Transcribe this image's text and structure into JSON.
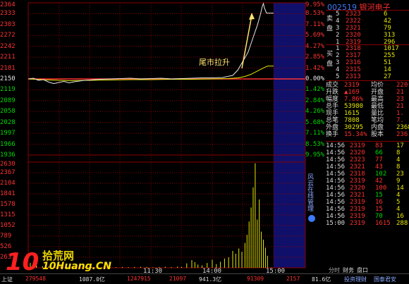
{
  "stock": {
    "code": "002519",
    "name": "银河电子"
  },
  "chart_data": {
    "type": "line",
    "prev_close": 2150,
    "y_ticks_left": [
      "2364",
      "2333",
      "2303",
      "2272",
      "2242",
      "2211",
      "2181",
      "2150",
      "2119",
      "2089",
      "2058",
      "2028",
      "1997",
      "1966",
      "1936"
    ],
    "y_ticks_right": [
      "9.95%",
      "8.53%",
      "7.11%",
      "5.69%",
      "4.27%",
      "2.85%",
      "1.42%",
      "0.00%",
      "1.42%",
      "2.84%",
      "4.26%",
      "5.68%",
      "7.11%",
      "8.53%",
      "9.95%"
    ],
    "volume_ticks": [
      "2630",
      "2367",
      "2104",
      "1841",
      "1578",
      "1315",
      "1052",
      "789",
      "526",
      "263"
    ],
    "x_ticks": [
      "11:30",
      "14:00",
      "15:00"
    ],
    "annotation": "尾市拉升",
    "price_series": [
      [
        0,
        2150
      ],
      [
        5,
        2152
      ],
      [
        10,
        2146
      ],
      [
        15,
        2148
      ],
      [
        20,
        2141
      ],
      [
        25,
        2137
      ],
      [
        30,
        2140
      ],
      [
        35,
        2143
      ],
      [
        40,
        2139
      ],
      [
        45,
        2142
      ],
      [
        50,
        2144
      ],
      [
        55,
        2146
      ],
      [
        60,
        2147
      ],
      [
        65,
        2148
      ],
      [
        70,
        2149
      ],
      [
        80,
        2150
      ],
      [
        90,
        2151
      ],
      [
        100,
        2152
      ],
      [
        110,
        2150
      ],
      [
        120,
        2151
      ],
      [
        130,
        2152
      ],
      [
        140,
        2150
      ],
      [
        150,
        2151
      ],
      [
        160,
        2152
      ],
      [
        170,
        2153
      ],
      [
        180,
        2153
      ],
      [
        190,
        2154
      ],
      [
        200,
        2160
      ],
      [
        205,
        2175
      ],
      [
        210,
        2200
      ],
      [
        215,
        2225
      ],
      [
        218,
        2250
      ],
      [
        221,
        2275
      ],
      [
        224,
        2300
      ],
      [
        227,
        2330
      ],
      [
        229,
        2355
      ],
      [
        230,
        2362
      ],
      [
        231,
        2350
      ],
      [
        233,
        2335
      ],
      [
        237,
        2335
      ],
      [
        240,
        2335
      ]
    ],
    "avg_series": [
      [
        0,
        2150
      ],
      [
        20,
        2147
      ],
      [
        40,
        2145
      ],
      [
        60,
        2146
      ],
      [
        80,
        2147
      ],
      [
        100,
        2148
      ],
      [
        120,
        2148
      ],
      [
        140,
        2149
      ],
      [
        160,
        2149
      ],
      [
        180,
        2150
      ],
      [
        195,
        2151
      ],
      [
        205,
        2153
      ],
      [
        212,
        2157
      ],
      [
        218,
        2163
      ],
      [
        224,
        2172
      ],
      [
        230,
        2181
      ],
      [
        234,
        2186
      ],
      [
        240,
        2186
      ]
    ],
    "volume_series": [
      [
        2,
        120
      ],
      [
        8,
        60
      ],
      [
        14,
        40
      ],
      [
        20,
        35
      ],
      [
        26,
        25
      ],
      [
        32,
        30
      ],
      [
        38,
        20
      ],
      [
        44,
        25
      ],
      [
        50,
        20
      ],
      [
        56,
        30
      ],
      [
        62,
        20
      ],
      [
        68,
        15
      ],
      [
        74,
        25
      ],
      [
        80,
        20
      ],
      [
        86,
        15
      ],
      [
        92,
        20
      ],
      [
        98,
        15
      ],
      [
        104,
        20
      ],
      [
        110,
        25
      ],
      [
        116,
        20
      ],
      [
        122,
        15
      ],
      [
        128,
        20
      ],
      [
        134,
        25
      ],
      [
        140,
        20
      ],
      [
        146,
        30
      ],
      [
        150,
        25
      ],
      [
        155,
        110
      ],
      [
        160,
        190
      ],
      [
        163,
        140
      ],
      [
        166,
        80
      ],
      [
        170,
        60
      ],
      [
        175,
        120
      ],
      [
        180,
        200
      ],
      [
        184,
        90
      ],
      [
        188,
        150
      ],
      [
        192,
        230
      ],
      [
        196,
        260
      ],
      [
        200,
        420
      ],
      [
        203,
        350
      ],
      [
        206,
        480
      ],
      [
        209,
        400
      ],
      [
        212,
        620
      ],
      [
        214,
        820
      ],
      [
        216,
        1150
      ],
      [
        218,
        1500
      ],
      [
        220,
        2000
      ],
      [
        222,
        2600
      ],
      [
        224,
        1200
      ],
      [
        226,
        1700
      ],
      [
        228,
        900
      ],
      [
        230,
        700
      ],
      [
        232,
        500
      ],
      [
        234,
        300
      ]
    ]
  },
  "order_book": {
    "sell_label": "卖盘",
    "buy_label": "买盘",
    "sells": [
      {
        "lvl": "5",
        "price": "2323",
        "vol": "6"
      },
      {
        "lvl": "4",
        "price": "2322",
        "vol": "42"
      },
      {
        "lvl": "3",
        "price": "2321",
        "vol": "79"
      },
      {
        "lvl": "2",
        "price": "2320",
        "vol": "313"
      },
      {
        "lvl": "1",
        "price": "2319",
        "vol": "296"
      }
    ],
    "buys": [
      {
        "lvl": "1",
        "price": "2318",
        "vol": "1017"
      },
      {
        "lvl": "2",
        "price": "2317",
        "vol": "255"
      },
      {
        "lvl": "3",
        "price": "2316",
        "vol": "51"
      },
      {
        "lvl": "4",
        "price": "2315",
        "vol": "14"
      },
      {
        "lvl": "5",
        "price": "2313",
        "vol": "27"
      }
    ]
  },
  "quote": [
    {
      "k1": "成交",
      "v1": "2319",
      "k2": "均价",
      "v2": "220"
    },
    {
      "k1": "升跌",
      "v1": "▲169",
      "k2": "开盘",
      "v2": "21"
    },
    {
      "k1": "幅度",
      "v1": "7.86%",
      "k2": "最高",
      "v2": "23"
    },
    {
      "k1": "总手",
      "v1": "53980",
      "k2": "最低",
      "v2": "21"
    },
    {
      "k1": "现手",
      "v1": "1615",
      "k2": "量比",
      "v2": "1."
    },
    {
      "k1": "总笔",
      "v1": "7808",
      "k2": "笔均",
      "v2": "7."
    },
    {
      "k1": "外盘",
      "v1": "30295",
      "k2": "内盘",
      "v2": "2368"
    },
    {
      "k1": "换手",
      "v1": "15.34%",
      "k2": "股本",
      "v2": "236"
    }
  ],
  "ticks": [
    {
      "t": "14:56",
      "p": "2319",
      "v": "83",
      "n": "17"
    },
    {
      "t": "14:56",
      "p": "2320",
      "v": "66",
      "n": "8"
    },
    {
      "t": "14:56",
      "p": "2323",
      "v": "77",
      "n": "4"
    },
    {
      "t": "14:56",
      "p": "2321",
      "v": "43",
      "n": "8"
    },
    {
      "t": "14:56",
      "p": "2318",
      "v": "102",
      "n": "23"
    },
    {
      "t": "14:56",
      "p": "2319",
      "v": "42",
      "n": "9"
    },
    {
      "t": "14:56",
      "p": "2320",
      "v": "100",
      "n": "14"
    },
    {
      "t": "14:56",
      "p": "2321",
      "v": "15",
      "n": "4"
    },
    {
      "t": "14:56",
      "p": "2319",
      "v": "16",
      "n": "5"
    },
    {
      "t": "14:56",
      "p": "2319",
      "v": "15",
      "n": "4"
    },
    {
      "t": "14:56",
      "p": "2319",
      "v": "70",
      "n": "16"
    },
    {
      "t": "15:00",
      "p": "2319",
      "v": "1615",
      "n": "288"
    }
  ],
  "side_tab": "风云在线管理",
  "panel_tabs": [
    "分时",
    "财务",
    "盘口"
  ],
  "status_bar": {
    "left": "上证",
    "v1": "279548",
    "v2": "1087.0亿",
    "v3": "1247915",
    "v4": "21097",
    "v5": "941.3亿",
    "v6": "91309",
    "v7": "2157",
    "v8": "81.6亿",
    "t1": "投资理财",
    "t2": "国泰君安"
  },
  "watermark": {
    "mark": "10",
    "site": "拾荒网",
    "domain": "10Huang.CN"
  }
}
